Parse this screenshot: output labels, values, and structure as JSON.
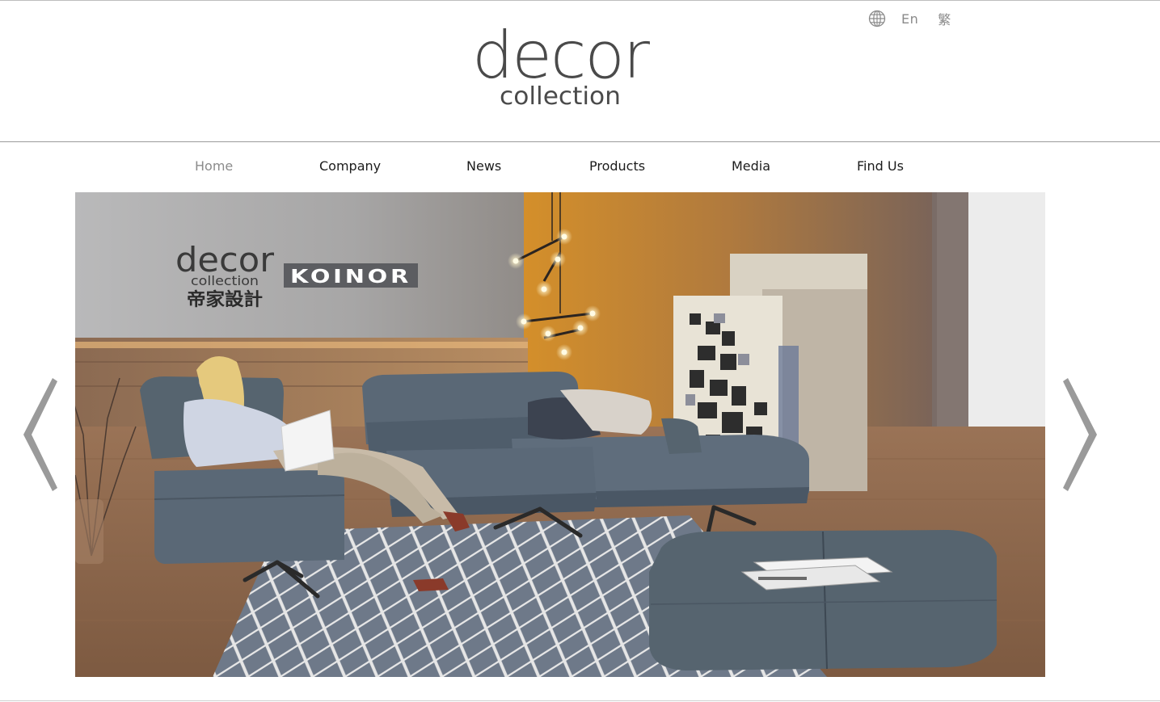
{
  "language": {
    "icon": "globe-icon",
    "options": [
      "En",
      "繁"
    ]
  },
  "brand": {
    "logo_word": "decor",
    "logo_sub": "collection"
  },
  "nav": {
    "items": [
      {
        "label": "Home",
        "active": true
      },
      {
        "label": "Company",
        "active": false
      },
      {
        "label": "News",
        "active": false
      },
      {
        "label": "Products",
        "active": false
      },
      {
        "label": "Media",
        "active": false
      },
      {
        "label": "Find Us",
        "active": false
      }
    ]
  },
  "hero": {
    "logo_word": "decor",
    "logo_sub": "collection",
    "logo_chinese": "帝家設計",
    "partner_brand": "KOINOR"
  },
  "carousel": {
    "prev_icon": "chevron-left-icon",
    "next_icon": "chevron-right-icon"
  },
  "colors": {
    "nav_active": "#8b8b8b",
    "nav_text": "#1c1c1c",
    "arrow": "#9a9a9a",
    "sofa": "#5a6876",
    "logo": "#4a4a4a"
  }
}
